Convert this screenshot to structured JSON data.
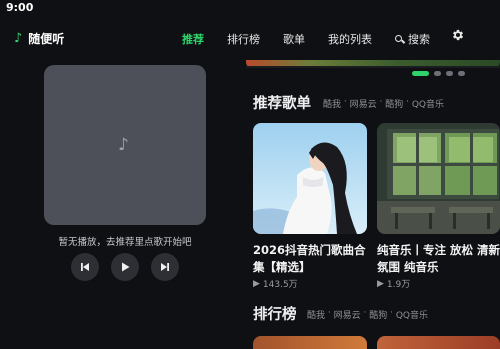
{
  "status": {
    "time": "9:00"
  },
  "app": {
    "name": "随便听"
  },
  "nav": {
    "recommend": "推荐",
    "charts": "排行榜",
    "songs": "歌单",
    "my_list": "我的列表",
    "search": "搜索"
  },
  "player": {
    "hint": "暂无播放，去推荐里点歌开始吧"
  },
  "playlists": {
    "title": "推荐歌单",
    "sources": [
      "酷我",
      "网易云",
      "酷狗",
      "QQ音乐"
    ],
    "items": [
      {
        "title": "2026抖音热门歌曲合集【精选】",
        "plays": "143.5万"
      },
      {
        "title": "纯音乐丨专注 放松 清新 氛围 纯音乐",
        "plays": "1.9万"
      }
    ]
  },
  "ranking": {
    "title": "排行榜",
    "sources": [
      "酷我",
      "网易云",
      "酷狗",
      "QQ音乐"
    ]
  },
  "colors": {
    "accent": "#2ed46b",
    "background": "#0f1013"
  }
}
